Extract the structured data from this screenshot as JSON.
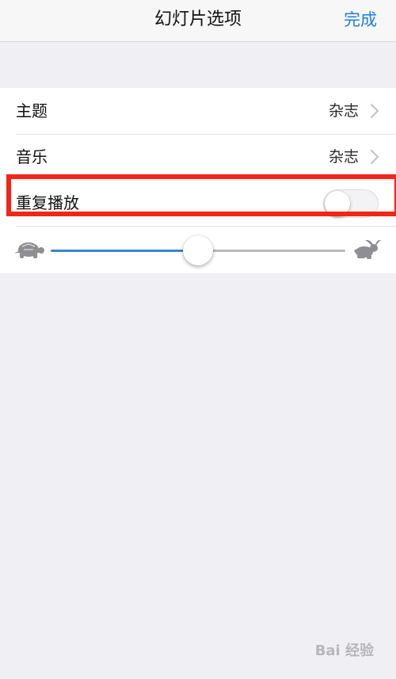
{
  "navbar": {
    "title": "幻灯片选项",
    "done_label": "完成",
    "accent_color": "#1a7fe0"
  },
  "settings": {
    "theme": {
      "label": "主题",
      "value": "杂志"
    },
    "music": {
      "label": "音乐",
      "value": "杂志"
    },
    "repeat": {
      "label": "重复播放",
      "enabled": false
    },
    "speed": {
      "level": 0.5,
      "slow_icon": "turtle-icon",
      "fast_icon": "hare-icon"
    }
  },
  "annotation": {
    "highlight_color": "#f22616"
  },
  "watermark": {
    "text": "Bai 经验"
  }
}
